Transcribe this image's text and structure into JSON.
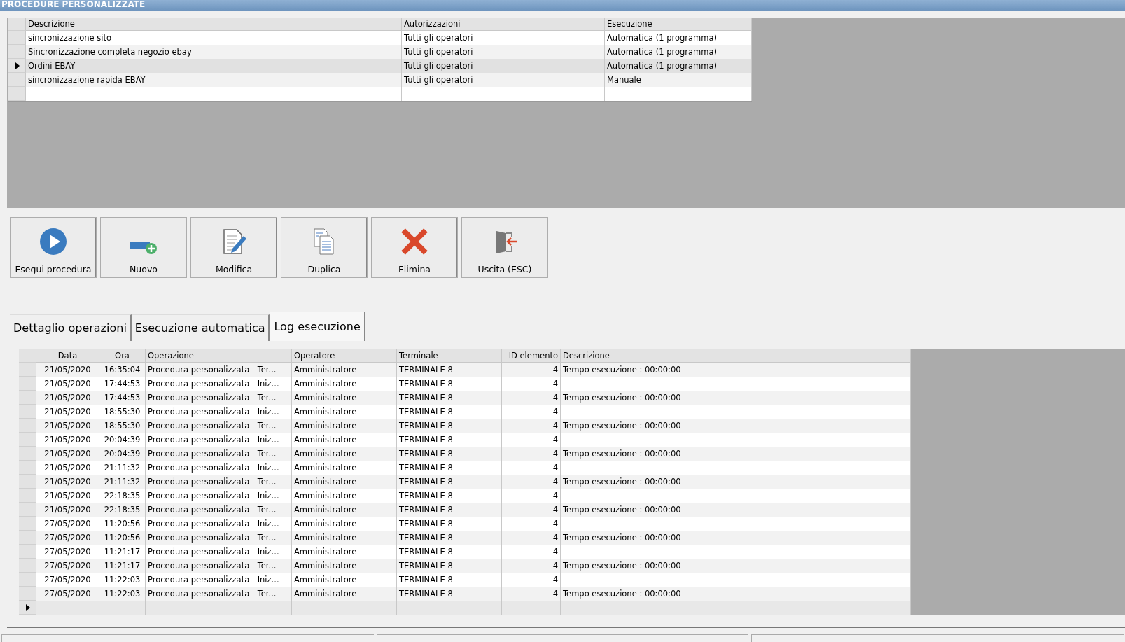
{
  "window": {
    "title": "PROCEDURE PERSONALIZZATE"
  },
  "procedures": {
    "columns": [
      "Descrizione",
      "Autorizzazioni",
      "Esecuzione"
    ],
    "rows": [
      {
        "cells": [
          "sincronizzazione sito",
          "Tutti gli operatori",
          "Automatica (1 programma)"
        ],
        "selected": false
      },
      {
        "cells": [
          "Sincronizzazione completa  negozio ebay",
          "Tutti gli operatori",
          "Automatica (1 programma)"
        ],
        "selected": false
      },
      {
        "cells": [
          "Ordini EBAY",
          "Tutti gli operatori",
          "Automatica (1 programma)"
        ],
        "selected": true
      },
      {
        "cells": [
          "sincronizzazione rapida EBAY",
          "Tutti gli operatori",
          "Manuale"
        ],
        "selected": false
      }
    ]
  },
  "buttons": [
    {
      "kind": "play",
      "label": "Esegui procedura"
    },
    {
      "kind": "new",
      "label": "Nuovo"
    },
    {
      "kind": "edit",
      "label": "Modifica"
    },
    {
      "kind": "copy",
      "label": "Duplica"
    },
    {
      "kind": "delete",
      "label": "Elimina"
    },
    {
      "kind": "exit",
      "label": "Uscita (ESC)"
    }
  ],
  "tabs": [
    {
      "label": "Dettaglio operazioni",
      "selected": false
    },
    {
      "label": "Esecuzione automatica",
      "selected": false
    },
    {
      "label": "Log esecuzione",
      "selected": true
    }
  ],
  "log": {
    "columns": [
      "Data",
      "Ora",
      "Operazione",
      "Operatore",
      "Terminale",
      "ID elemento",
      "Descrizione"
    ],
    "rows": [
      [
        "21/05/2020",
        "16:35:04",
        "Procedura personalizzata - Ter...",
        "Amministratore",
        "TERMINALE 8",
        "4",
        "Tempo esecuzione : 00:00:00"
      ],
      [
        "21/05/2020",
        "17:44:53",
        "Procedura personalizzata - Iniz...",
        "Amministratore",
        "TERMINALE 8",
        "4",
        ""
      ],
      [
        "21/05/2020",
        "17:44:53",
        "Procedura personalizzata - Ter...",
        "Amministratore",
        "TERMINALE 8",
        "4",
        "Tempo esecuzione : 00:00:00"
      ],
      [
        "21/05/2020",
        "18:55:30",
        "Procedura personalizzata - Iniz...",
        "Amministratore",
        "TERMINALE 8",
        "4",
        ""
      ],
      [
        "21/05/2020",
        "18:55:30",
        "Procedura personalizzata - Ter...",
        "Amministratore",
        "TERMINALE 8",
        "4",
        "Tempo esecuzione : 00:00:00"
      ],
      [
        "21/05/2020",
        "20:04:39",
        "Procedura personalizzata - Iniz...",
        "Amministratore",
        "TERMINALE 8",
        "4",
        ""
      ],
      [
        "21/05/2020",
        "20:04:39",
        "Procedura personalizzata - Ter...",
        "Amministratore",
        "TERMINALE 8",
        "4",
        "Tempo esecuzione : 00:00:00"
      ],
      [
        "21/05/2020",
        "21:11:32",
        "Procedura personalizzata - Iniz...",
        "Amministratore",
        "TERMINALE 8",
        "4",
        ""
      ],
      [
        "21/05/2020",
        "21:11:32",
        "Procedura personalizzata - Ter...",
        "Amministratore",
        "TERMINALE 8",
        "4",
        "Tempo esecuzione : 00:00:00"
      ],
      [
        "21/05/2020",
        "22:18:35",
        "Procedura personalizzata - Iniz...",
        "Amministratore",
        "TERMINALE 8",
        "4",
        ""
      ],
      [
        "21/05/2020",
        "22:18:35",
        "Procedura personalizzata - Ter...",
        "Amministratore",
        "TERMINALE 8",
        "4",
        "Tempo esecuzione : 00:00:00"
      ],
      [
        "27/05/2020",
        "11:20:56",
        "Procedura personalizzata - Iniz...",
        "Amministratore",
        "TERMINALE 8",
        "4",
        ""
      ],
      [
        "27/05/2020",
        "11:20:56",
        "Procedura personalizzata - Ter...",
        "Amministratore",
        "TERMINALE 8",
        "4",
        "Tempo esecuzione : 00:00:00"
      ],
      [
        "27/05/2020",
        "11:21:17",
        "Procedura personalizzata - Iniz...",
        "Amministratore",
        "TERMINALE 8",
        "4",
        ""
      ],
      [
        "27/05/2020",
        "11:21:17",
        "Procedura personalizzata - Ter...",
        "Amministratore",
        "TERMINALE 8",
        "4",
        "Tempo esecuzione : 00:00:00"
      ],
      [
        "27/05/2020",
        "11:22:03",
        "Procedura personalizzata - Iniz...",
        "Amministratore",
        "TERMINALE 8",
        "4",
        ""
      ],
      [
        "27/05/2020",
        "11:22:03",
        "Procedura personalizzata - Ter...",
        "Amministratore",
        "TERMINALE 8",
        "4",
        "Tempo esecuzione : 00:00:00"
      ]
    ],
    "new_row_current": true
  }
}
